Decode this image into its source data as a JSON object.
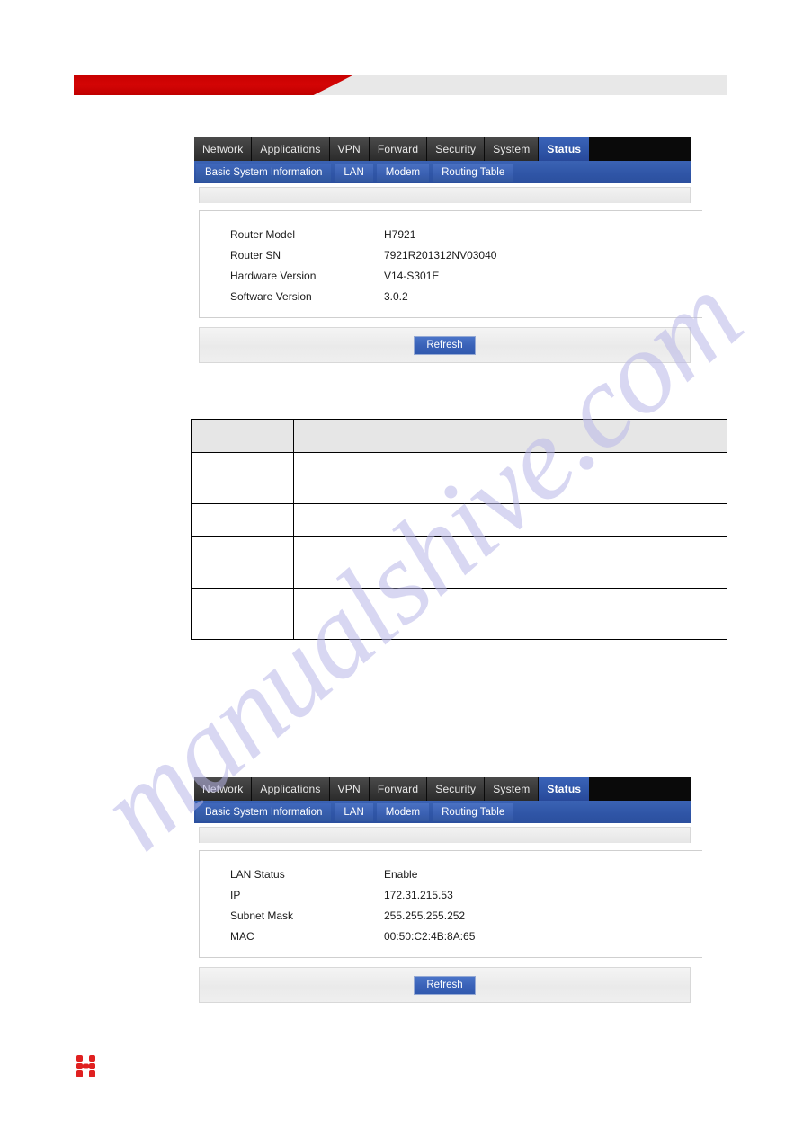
{
  "banner": {
    "accent_color": "#c80000",
    "strip_color": "#e8e8e8"
  },
  "watermark": {
    "text": "manualshive.com",
    "color": "#b9b7e8"
  },
  "nav": {
    "main_tabs": [
      {
        "label": "Network",
        "active": false
      },
      {
        "label": "Applications",
        "active": false
      },
      {
        "label": "VPN",
        "active": false
      },
      {
        "label": "Forward",
        "active": false
      },
      {
        "label": "Security",
        "active": false
      },
      {
        "label": "System",
        "active": false
      },
      {
        "label": "Status",
        "active": true
      }
    ],
    "sub_tabs": [
      {
        "label": "Basic System Information",
        "active": true
      },
      {
        "label": "LAN",
        "active": false
      },
      {
        "label": "Modem",
        "active": false
      },
      {
        "label": "Routing Table",
        "active": false
      }
    ],
    "active_tab_color": "#2f55a8",
    "bar_color": "#0a0a0a"
  },
  "panel_basic": {
    "title": "",
    "rows": [
      {
        "label": "Router Model",
        "value": "H7921"
      },
      {
        "label": "Router SN",
        "value": "7921R201312NV03040"
      },
      {
        "label": "Hardware Version",
        "value": "V14-S301E"
      },
      {
        "label": "Software Version",
        "value": "3.0.2"
      }
    ],
    "refresh_label": "Refresh"
  },
  "panel_lan": {
    "title": "",
    "rows": [
      {
        "label": "LAN Status",
        "value": "Enable"
      },
      {
        "label": "IP",
        "value": "172.31.215.53"
      },
      {
        "label": "Subnet Mask",
        "value": "255.255.255.252"
      },
      {
        "label": "MAC",
        "value": "00:50:C2:4B:8A:65"
      }
    ],
    "refresh_label": "Refresh"
  },
  "blank_table": {
    "headers": [
      "",
      "",
      ""
    ],
    "rows": [
      [
        "",
        "",
        ""
      ],
      [
        "",
        "",
        ""
      ],
      [
        "",
        "",
        ""
      ],
      [
        "",
        "",
        ""
      ]
    ]
  },
  "footer": {
    "logo_name": "h-brand-logo",
    "logo_color": "#e02020"
  }
}
